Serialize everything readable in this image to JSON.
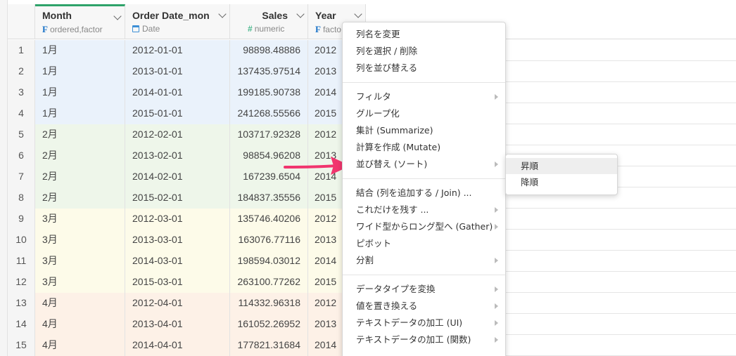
{
  "columns": [
    {
      "name": "Month",
      "type": "ordered,factor",
      "type_icon": "F"
    },
    {
      "name": "Order Date_mon",
      "type": "Date",
      "type_icon": "calendar"
    },
    {
      "name": "Sales",
      "type": "numeric",
      "type_icon": "#"
    },
    {
      "name": "Year",
      "type": "facto",
      "type_icon": "F"
    }
  ],
  "rows": [
    {
      "idx": "1",
      "month": "1月",
      "date": "2012-01-01",
      "sales": "98898.48886",
      "year": "2012"
    },
    {
      "idx": "2",
      "month": "1月",
      "date": "2013-01-01",
      "sales": "137435.97514",
      "year": "2013"
    },
    {
      "idx": "3",
      "month": "1月",
      "date": "2014-01-01",
      "sales": "199185.90738",
      "year": "2014"
    },
    {
      "idx": "4",
      "month": "1月",
      "date": "2015-01-01",
      "sales": "241268.55566",
      "year": "2015"
    },
    {
      "idx": "5",
      "month": "2月",
      "date": "2012-02-01",
      "sales": "103717.92328",
      "year": "2012"
    },
    {
      "idx": "6",
      "month": "2月",
      "date": "2013-02-01",
      "sales": "98854.96208",
      "year": "2013"
    },
    {
      "idx": "7",
      "month": "2月",
      "date": "2014-02-01",
      "sales": "167239.6504",
      "year": "2014"
    },
    {
      "idx": "8",
      "month": "2月",
      "date": "2015-02-01",
      "sales": "184837.35556",
      "year": "2015"
    },
    {
      "idx": "9",
      "month": "3月",
      "date": "2012-03-01",
      "sales": "135746.40206",
      "year": "2012"
    },
    {
      "idx": "10",
      "month": "3月",
      "date": "2013-03-01",
      "sales": "163076.77116",
      "year": "2013"
    },
    {
      "idx": "11",
      "month": "3月",
      "date": "2014-03-01",
      "sales": "198594.03012",
      "year": "2014"
    },
    {
      "idx": "12",
      "month": "3月",
      "date": "2015-03-01",
      "sales": "263100.77262",
      "year": "2015"
    },
    {
      "idx": "13",
      "month": "4月",
      "date": "2012-04-01",
      "sales": "114332.96318",
      "year": "2012"
    },
    {
      "idx": "14",
      "month": "4月",
      "date": "2013-04-01",
      "sales": "161052.26952",
      "year": "2013"
    },
    {
      "idx": "15",
      "month": "4月",
      "date": "2014-04-01",
      "sales": "177821.31684",
      "year": "2014"
    }
  ],
  "menu": {
    "group1": [
      {
        "label": "列名を変更",
        "has_sub": false
      },
      {
        "label": "列を選択 / 削除",
        "has_sub": false
      },
      {
        "label": "列を並び替える",
        "has_sub": false
      }
    ],
    "group2": [
      {
        "label": "フィルタ",
        "has_sub": true
      },
      {
        "label": "グループ化",
        "has_sub": false
      },
      {
        "label": "集計 (Summarize)",
        "has_sub": false
      },
      {
        "label": "計算を作成 (Mutate)",
        "has_sub": false
      },
      {
        "label": "並び替え (ソート)",
        "has_sub": true
      }
    ],
    "group3": [
      {
        "label": "結合 (列を追加する / Join) ...",
        "has_sub": false
      },
      {
        "label": "これだけを残す ...",
        "has_sub": true
      },
      {
        "label": "ワイド型からロング型へ (Gather)",
        "has_sub": true
      },
      {
        "label": "ピボット",
        "has_sub": false
      },
      {
        "label": "分割",
        "has_sub": true
      }
    ],
    "group4": [
      {
        "label": "データタイプを変換",
        "has_sub": true
      },
      {
        "label": "値を置き換える",
        "has_sub": true
      },
      {
        "label": "テキストデータの加工 (UI)",
        "has_sub": true
      },
      {
        "label": "テキストデータの加工 (関数)",
        "has_sub": true
      }
    ]
  },
  "submenu": [
    {
      "label": "昇順"
    },
    {
      "label": "降順"
    }
  ],
  "colors": {
    "accent": "#2ea36a",
    "arrow": "#f1356e",
    "month_1": "#eaf2fb",
    "month_2": "#eef6ea",
    "month_3": "#fdfbe9",
    "month_4": "#fdf1e7"
  }
}
